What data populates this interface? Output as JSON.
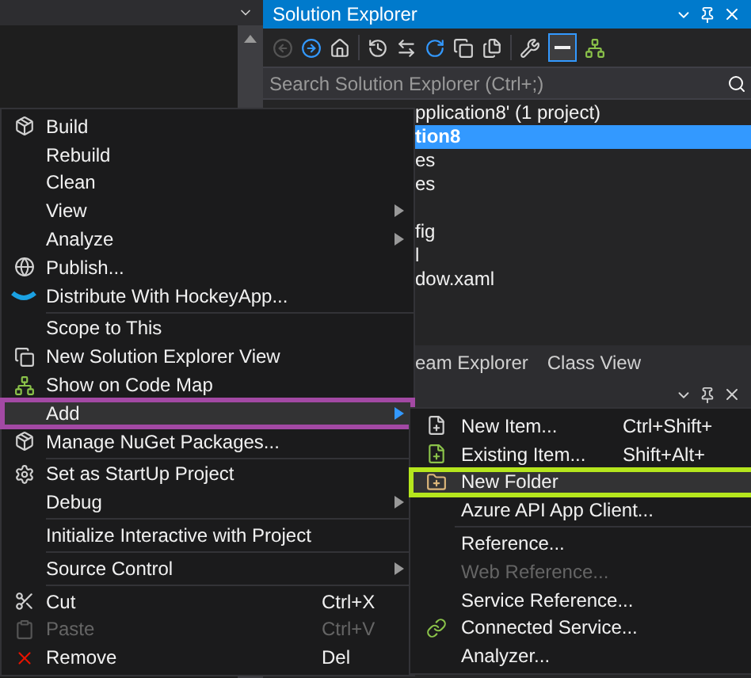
{
  "solution_explorer": {
    "title": "Solution Explorer",
    "search": {
      "placeholder": "Search Solution Explorer (Ctrl+;)"
    },
    "tree": [
      {
        "text": "pplication8' (1 project)",
        "selected": false,
        "gap_before": false
      },
      {
        "text": "tion8",
        "selected": true,
        "gap_before": false
      },
      {
        "text": "es",
        "selected": false,
        "gap_before": false
      },
      {
        "text": "es",
        "selected": false,
        "gap_before": false
      },
      {
        "text": "fig",
        "selected": false,
        "gap_before": true
      },
      {
        "text": "l",
        "selected": false,
        "gap_before": false
      },
      {
        "text": "dow.xaml",
        "selected": false,
        "gap_before": false
      }
    ],
    "tabs": [
      {
        "label": "eam Explorer",
        "selected": false
      },
      {
        "label": "Class View",
        "selected": false
      }
    ]
  },
  "context_menu": [
    {
      "kind": "item",
      "label": "Build",
      "selected": false,
      "disabled": false,
      "submenu": false
    },
    {
      "kind": "item",
      "label": "Rebuild",
      "selected": false,
      "disabled": false,
      "submenu": false
    },
    {
      "kind": "item",
      "label": "Clean",
      "selected": false,
      "disabled": false,
      "submenu": false
    },
    {
      "kind": "item",
      "label": "View",
      "selected": false,
      "disabled": false,
      "submenu": true
    },
    {
      "kind": "item",
      "label": "Analyze",
      "selected": false,
      "disabled": false,
      "submenu": true
    },
    {
      "kind": "item",
      "label": "Publish...",
      "selected": false,
      "disabled": false,
      "submenu": false
    },
    {
      "kind": "item",
      "label": "Distribute With HockeyApp...",
      "selected": false,
      "disabled": false,
      "submenu": false
    },
    {
      "kind": "separator"
    },
    {
      "kind": "item",
      "label": "Scope to This",
      "selected": false,
      "disabled": false,
      "submenu": false
    },
    {
      "kind": "item",
      "label": "New Solution Explorer View",
      "selected": false,
      "disabled": false,
      "submenu": false
    },
    {
      "kind": "item",
      "label": "Show on Code Map",
      "selected": false,
      "disabled": false,
      "submenu": false
    },
    {
      "kind": "item",
      "label": "Add",
      "selected": true,
      "disabled": false,
      "submenu": true
    },
    {
      "kind": "item",
      "label": "Manage NuGet Packages...",
      "selected": false,
      "disabled": false,
      "submenu": false
    },
    {
      "kind": "separator"
    },
    {
      "kind": "item",
      "label": "Set as StartUp Project",
      "selected": false,
      "disabled": false,
      "submenu": false
    },
    {
      "kind": "item",
      "label": "Debug",
      "selected": false,
      "disabled": false,
      "submenu": true
    },
    {
      "kind": "separator"
    },
    {
      "kind": "item",
      "label": "Initialize Interactive with Project",
      "selected": false,
      "disabled": false,
      "submenu": false
    },
    {
      "kind": "separator"
    },
    {
      "kind": "item",
      "label": "Source Control",
      "selected": false,
      "disabled": false,
      "submenu": true
    },
    {
      "kind": "separator"
    },
    {
      "kind": "item",
      "label": "Cut",
      "shortcut": "Ctrl+X",
      "selected": false,
      "disabled": false,
      "submenu": false
    },
    {
      "kind": "item",
      "label": "Paste",
      "shortcut": "Ctrl+V",
      "selected": false,
      "disabled": true,
      "submenu": false
    },
    {
      "kind": "item",
      "label": "Remove",
      "shortcut": "Del",
      "selected": false,
      "disabled": false,
      "submenu": false
    }
  ],
  "add_submenu": [
    {
      "kind": "item",
      "label": "New Item...",
      "shortcut": "Ctrl+Shift+",
      "selected": false,
      "disabled": false
    },
    {
      "kind": "item",
      "label": "Existing Item...",
      "shortcut": "Shift+Alt+",
      "selected": false,
      "disabled": false
    },
    {
      "kind": "item",
      "label": "New Folder",
      "selected": true,
      "disabled": false
    },
    {
      "kind": "item",
      "label": "Azure API App Client...",
      "selected": false,
      "disabled": false
    },
    {
      "kind": "separator"
    },
    {
      "kind": "item",
      "label": "Reference...",
      "selected": false,
      "disabled": false
    },
    {
      "kind": "item",
      "label": "Web Reference...",
      "selected": false,
      "disabled": true
    },
    {
      "kind": "item",
      "label": "Service Reference...",
      "selected": false,
      "disabled": false
    },
    {
      "kind": "item",
      "label": "Connected Service...",
      "selected": false,
      "disabled": false
    },
    {
      "kind": "item",
      "label": "Analyzer...",
      "selected": false,
      "disabled": false
    }
  ]
}
